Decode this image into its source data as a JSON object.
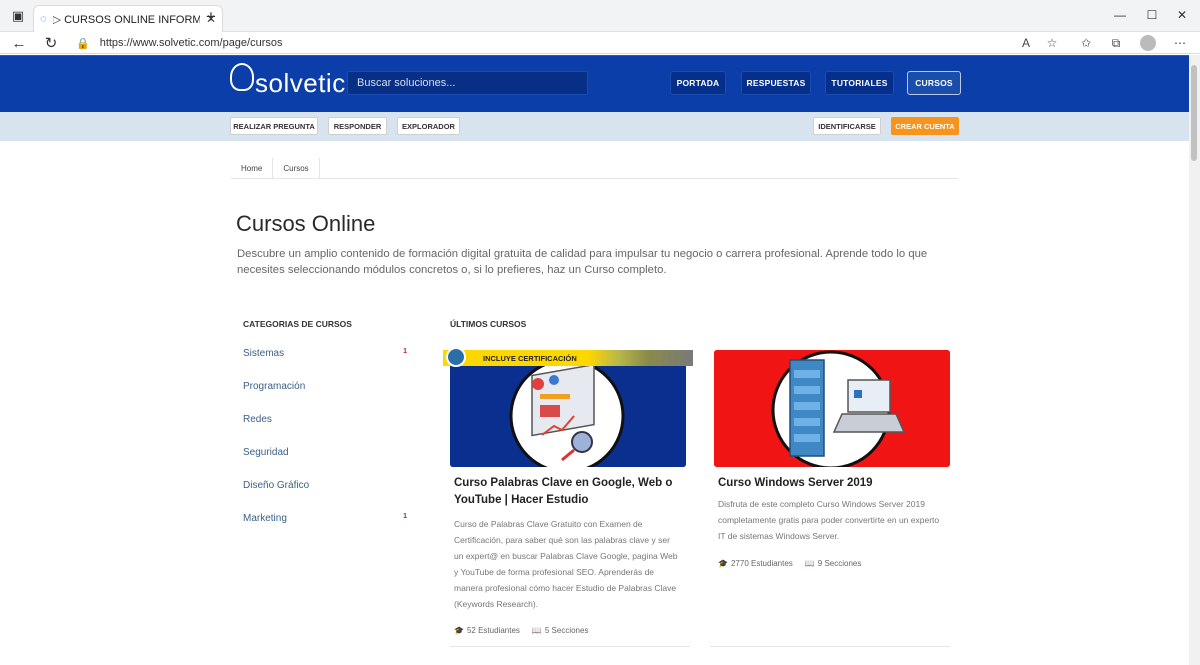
{
  "browser": {
    "tab_title": "▷ CURSOS ONLINE INFORMATICA",
    "url": "https://www.solvetic.com/page/cursos"
  },
  "header": {
    "logo_text": "solvetic",
    "search_placeholder": "Buscar soluciones...",
    "nav": [
      {
        "label": "PORTADA"
      },
      {
        "label": "RESPUESTAS"
      },
      {
        "label": "TUTORIALES"
      },
      {
        "label": "CURSOS"
      }
    ]
  },
  "subnav": {
    "left": [
      {
        "label": "REALIZAR PREGUNTA"
      },
      {
        "label": "RESPONDER"
      },
      {
        "label": "EXPLORADOR"
      }
    ],
    "login": "IDENTIFICARSE",
    "signup": "CREAR CUENTA"
  },
  "breadcrumb": [
    "Home",
    "Cursos"
  ],
  "page": {
    "title": "Cursos Online",
    "description": "Descubre un amplio contenido de formación digital gratuita de calidad para impulsar tu negocio o carrera profesional. Aprende todo lo que necesites seleccionando módulos concretos o, si lo prefieres, haz un Curso completo."
  },
  "sidebar": {
    "heading": "CATEGORIAS DE CURSOS",
    "categories": [
      {
        "label": "Sistemas",
        "count": "1"
      },
      {
        "label": "Programación",
        "count": ""
      },
      {
        "label": "Redes",
        "count": ""
      },
      {
        "label": "Seguridad",
        "count": ""
      },
      {
        "label": "Diseño Gráfico",
        "count": ""
      },
      {
        "label": "Marketing",
        "count": "1"
      }
    ]
  },
  "courses": {
    "heading": "ÚLTIMOS CURSOS",
    "items": [
      {
        "badge": "INCLUYE CERTIFICACIÓN",
        "title": "Curso Palabras Clave en Google, Web o YouTube | Hacer Estudio",
        "description": "Curso de Palabras Clave Gratuito con Examen de Certificación, para saber qué son las palabras clave y ser un expert@ en buscar Palabras Clave Google, pagina Web y YouTube de forma profesional SEO. Aprenderás de manera profesional cómo hacer Estudio de Palabras Clave (Keywords Research).",
        "students": "52 Estudiantes",
        "sections": "5 Secciones"
      },
      {
        "title": "Curso Windows Server 2019",
        "description": "Disfruta de este completo Curso Windows Server 2019 completamente gratis para poder convertirte en un experto IT de sistemas Windows Server.",
        "students": "2770 Estudiantes",
        "sections": "9 Secciones"
      }
    ]
  },
  "colors": {
    "header_bg": "#0b3ea8",
    "subnav_bg": "#d7e3ef",
    "accent_orange": "#f7941d",
    "card1_bg": "#0b2f8e",
    "card2_bg": "#f01414"
  }
}
